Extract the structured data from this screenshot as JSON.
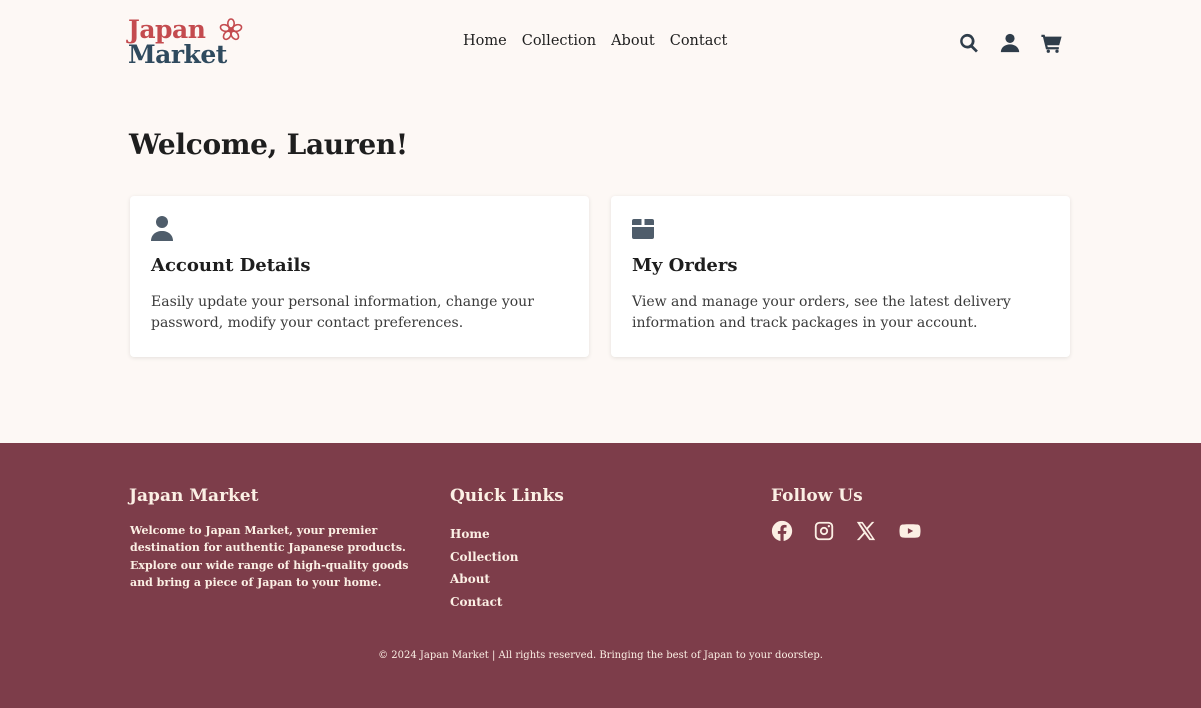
{
  "brand": {
    "logo_line1": "Japan",
    "logo_line2": "Market",
    "logo_color_primary": "#c44b4f",
    "logo_color_secondary": "#2f4a5e"
  },
  "nav": {
    "items": [
      {
        "label": "Home"
      },
      {
        "label": "Collection"
      },
      {
        "label": "About"
      },
      {
        "label": "Contact"
      }
    ]
  },
  "header_icons": [
    "search-icon",
    "user-icon",
    "cart-icon"
  ],
  "main": {
    "title": "Welcome, Lauren!",
    "cards": [
      {
        "icon": "user-icon",
        "title": "Account Details",
        "text": "Easily update your personal information, change your password, modify your contact preferences."
      },
      {
        "icon": "box-icon",
        "title": "My Orders",
        "text": "View and manage your orders, see the latest delivery information and track packages in your account."
      }
    ]
  },
  "footer": {
    "background": "#7d3d4a",
    "about_title": "Japan Market",
    "about_text": "Welcome to Japan Market, your premier destination for authentic Japanese products. Explore our wide range of high-quality goods and bring a piece of Japan to your home.",
    "links_title": "Quick Links",
    "links": [
      {
        "label": "Home"
      },
      {
        "label": "Collection"
      },
      {
        "label": "About"
      },
      {
        "label": "Contact"
      }
    ],
    "follow_title": "Follow Us",
    "social_icons": [
      "facebook-icon",
      "instagram-icon",
      "x-icon",
      "youtube-icon"
    ],
    "copyright": "© 2024 Japan Market | All rights reserved. Bringing the best of Japan to your doorstep."
  }
}
